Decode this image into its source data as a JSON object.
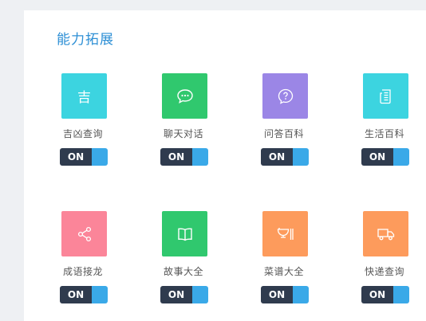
{
  "section": {
    "title": "能力拓展"
  },
  "colors": {
    "title": "#2d8fd5",
    "toggle_dark": "#2f3b4e",
    "toggle_knob": "#3aa9e8"
  },
  "abilities": [
    {
      "label": "吉凶查询",
      "icon": "ji-character-icon",
      "glyph": "吉",
      "color": "#3cd4e0",
      "toggle": "ON"
    },
    {
      "label": "聊天对话",
      "icon": "chat-bubble-icon",
      "color": "#30c86e",
      "toggle": "ON"
    },
    {
      "label": "问答百科",
      "icon": "question-icon",
      "color": "#9b86e6",
      "toggle": "ON"
    },
    {
      "label": "生活百科",
      "icon": "document-icon",
      "color": "#3cd4e0",
      "toggle": "ON"
    },
    {
      "label": "成语接龙",
      "icon": "share-icon",
      "color": "#fb8599",
      "toggle": "ON"
    },
    {
      "label": "故事大全",
      "icon": "book-icon",
      "color": "#30c86e",
      "toggle": "ON"
    },
    {
      "label": "菜谱大全",
      "icon": "cooking-icon",
      "color": "#fd9b5c",
      "toggle": "ON"
    },
    {
      "label": "快递查询",
      "icon": "truck-icon",
      "color": "#fd9b5c",
      "toggle": "ON"
    }
  ]
}
